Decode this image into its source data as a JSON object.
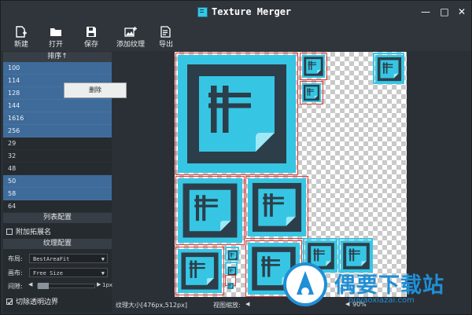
{
  "window": {
    "title": "Texture Merger",
    "minimize": "—",
    "maximize": "□",
    "close": "✕"
  },
  "toolbar": [
    {
      "label": "新建",
      "icon": "new-file-icon"
    },
    {
      "label": "打开",
      "icon": "folder-open-icon"
    },
    {
      "label": "保存",
      "icon": "save-icon"
    },
    {
      "label": "添加纹理",
      "icon": "add-texture-icon"
    },
    {
      "label": "导出",
      "icon": "export-icon"
    }
  ],
  "sidebar": {
    "sort_header": "排序↑",
    "items": [
      {
        "label": "100",
        "selected": true
      },
      {
        "label": "114",
        "selected": true
      },
      {
        "label": "128",
        "selected": true
      },
      {
        "label": "144",
        "selected": true
      },
      {
        "label": "1616",
        "selected": true
      },
      {
        "label": "256",
        "selected": true
      },
      {
        "label": "29",
        "selected": false
      },
      {
        "label": "32",
        "selected": false
      },
      {
        "label": "48",
        "selected": false
      },
      {
        "label": "50",
        "selected": true
      },
      {
        "label": "58",
        "selected": true
      },
      {
        "label": "64",
        "selected": false
      }
    ],
    "context_menu": {
      "delete": "删除"
    },
    "list_config_header": "列表配置",
    "append_ext_label": "附加拓展名",
    "append_ext_checked": false,
    "texture_config_header": "纹理配置",
    "layout_label": "布局:",
    "layout_value": "BestAreaFit",
    "canvas_label": "画布:",
    "canvas_value": "Free Size",
    "gap_label": "间隙:",
    "gap_value": "1px",
    "trim_label": "切除透明边界",
    "trim_checked": true
  },
  "status": {
    "texture_size": "纹理大小[476px,512px]",
    "zoom_label": "视图缩放:",
    "zoom_value": "90%"
  },
  "watermark": {
    "text": "偶要下载站",
    "url": "ouyaoxiazai.com"
  },
  "colors": {
    "accent": "#39c7e6",
    "selection": "#3e6b99",
    "sprite_border": "#d9403f"
  }
}
